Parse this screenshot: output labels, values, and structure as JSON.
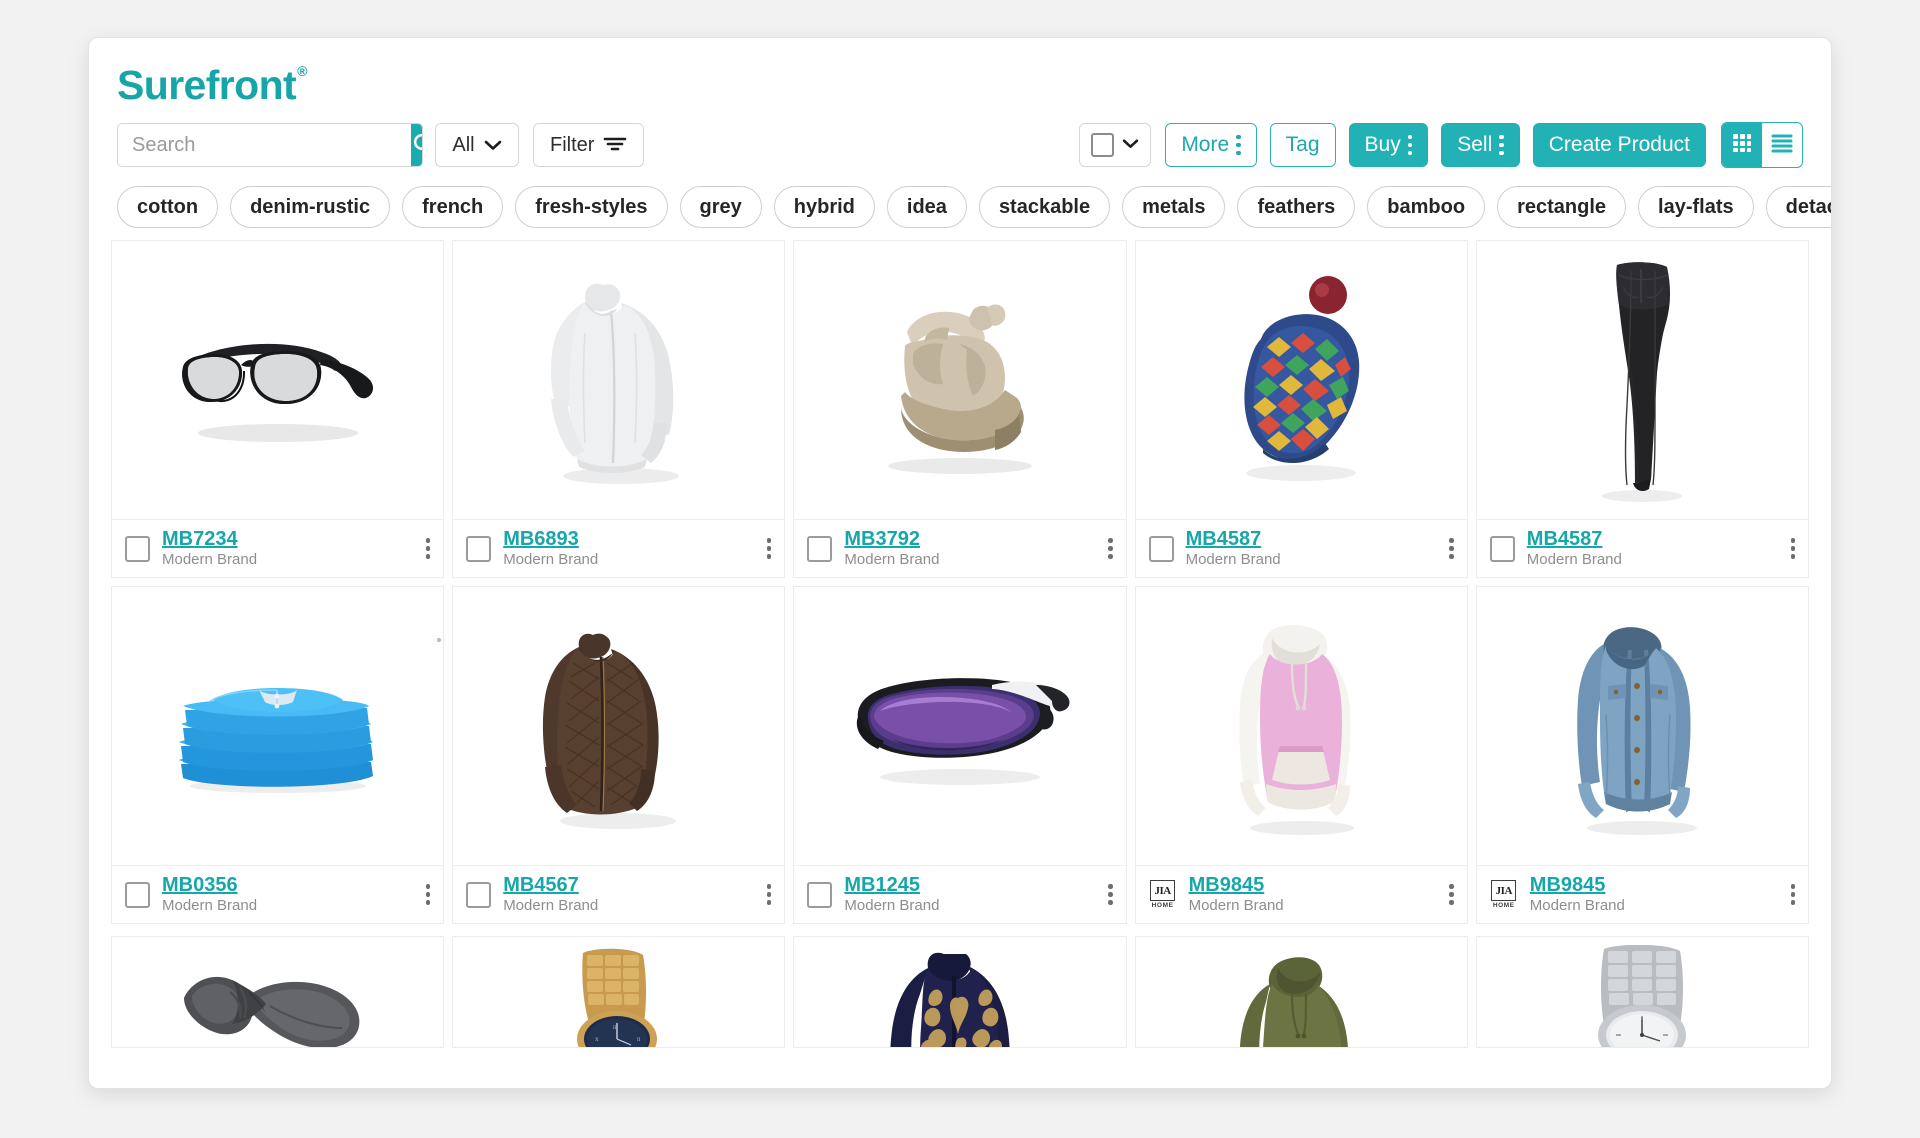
{
  "app": {
    "brand_name": "Surefront",
    "brand_reg": "®",
    "brand_color": "#18a5a8",
    "accent_color": "#22b2b6"
  },
  "search": {
    "placeholder": "Search",
    "value": "",
    "icon": "search-icon",
    "button_label": ""
  },
  "toolbar": {
    "scope_label": "All",
    "scope_caret": "chevron-down-icon",
    "filter_label": "Filter",
    "filter_icon": "filter-lines-icon",
    "select_dropdown_icon": "chevron-down-icon",
    "more_label": "More",
    "tag_label": "Tag",
    "buy_label": "Buy",
    "sell_label": "Sell",
    "create_product_label": "Create Product",
    "view_grid_icon": "grid-view-icon",
    "view_list_icon": "list-view-icon",
    "view_active": "grid"
  },
  "tags": [
    {
      "label": "cotton"
    },
    {
      "label": "denim-rustic"
    },
    {
      "label": "french"
    },
    {
      "label": "fresh-styles"
    },
    {
      "label": "grey"
    },
    {
      "label": "hybrid"
    },
    {
      "label": "idea"
    },
    {
      "label": "stackable"
    },
    {
      "label": "metals"
    },
    {
      "label": "feathers"
    },
    {
      "label": "bamboo"
    },
    {
      "label": "rectangle"
    },
    {
      "label": "lay-flats"
    },
    {
      "label": "detached"
    }
  ],
  "products": [
    {
      "sku": "MB7234",
      "brand": "Modern Brand",
      "image": "eyeglasses",
      "marker": "checkbox"
    },
    {
      "sku": "MB6893",
      "brand": "Modern Brand",
      "image": "white-jacket",
      "marker": "checkbox"
    },
    {
      "sku": "MB3792",
      "brand": "Modern Brand",
      "image": "beige-shoe",
      "marker": "checkbox"
    },
    {
      "sku": "MB4587",
      "brand": "Modern Brand",
      "image": "knit-beanie",
      "marker": "checkbox"
    },
    {
      "sku": "MB4587",
      "brand": "Modern Brand",
      "image": "black-jeans",
      "marker": "checkbox"
    },
    {
      "sku": "MB0356",
      "brand": "Modern Brand",
      "image": "blue-folded-shirts",
      "marker": "checkbox"
    },
    {
      "sku": "MB4567",
      "brand": "Modern Brand",
      "image": "brown-quilted-jacket",
      "marker": "checkbox"
    },
    {
      "sku": "MB1245",
      "brand": "Modern Brand",
      "image": "sport-sunglasses",
      "marker": "checkbox"
    },
    {
      "sku": "MB9845",
      "brand": "Modern Brand",
      "image": "pink-hoodie",
      "marker": "brandmark",
      "brandmark_text": "JIA",
      "brandmark_sub": "HOME"
    },
    {
      "sku": "MB9845",
      "brand": "Modern Brand",
      "image": "denim-jacket",
      "marker": "brandmark",
      "brandmark_text": "JIA",
      "brandmark_sub": "HOME"
    }
  ],
  "products_partial": [
    {
      "image": "grey-scarf"
    },
    {
      "image": "gold-watch"
    },
    {
      "image": "navy-embroidered-jacket"
    },
    {
      "image": "olive-hoodie"
    },
    {
      "image": "silver-watch"
    }
  ]
}
